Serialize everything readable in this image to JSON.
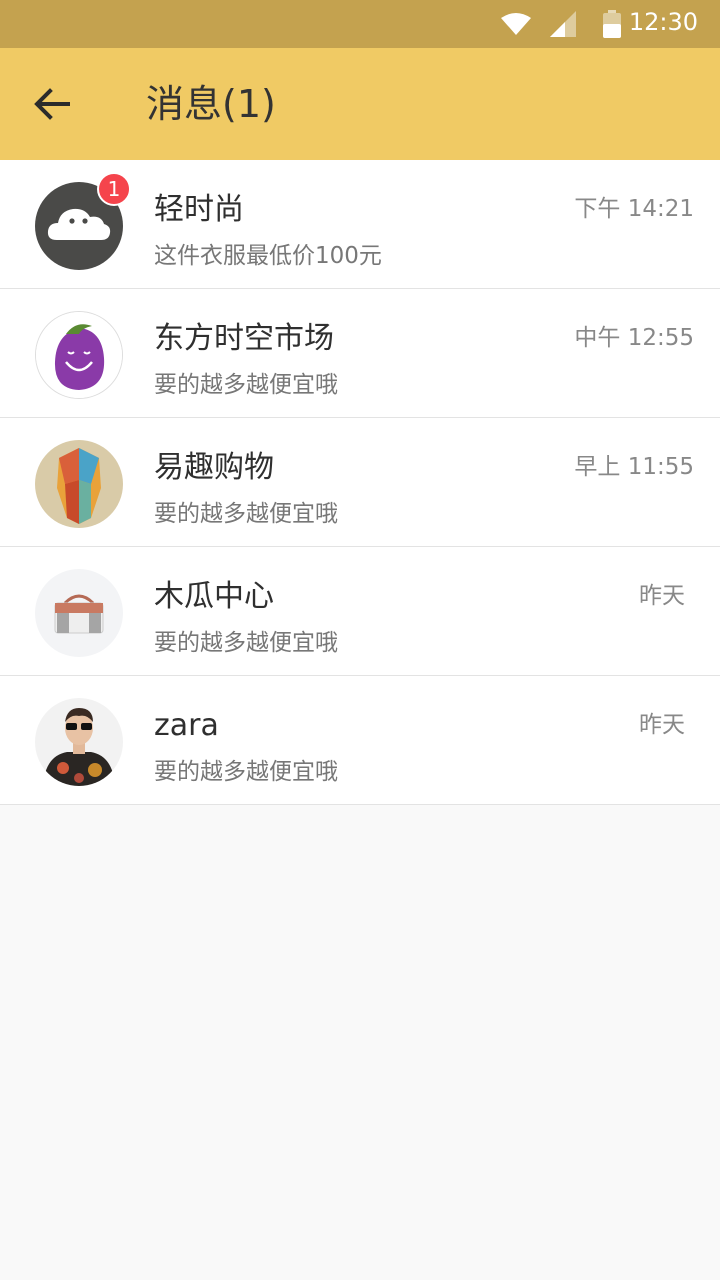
{
  "status_bar": {
    "time": "12:30",
    "icons": [
      "wifi-icon",
      "cellular-signal-icon",
      "battery-icon"
    ],
    "color": "#c4a24f"
  },
  "header": {
    "title": "消息(1)",
    "back_icon": "arrow-left-icon",
    "color": "#f0ca64"
  },
  "conversations": [
    {
      "name": "轻时尚",
      "preview": "这件衣服最低价100元",
      "time": "下午 14:21",
      "unread": "1",
      "avatar": "cloud-avatar"
    },
    {
      "name": "东方时空市场",
      "preview": "要的越多越便宜哦",
      "time": "中午 12:55",
      "avatar": "eggplant-avatar"
    },
    {
      "name": "易趣购物",
      "preview": "要的越多越便宜哦",
      "time": "早上 11:55",
      "avatar": "geometric-face-avatar"
    },
    {
      "name": "木瓜中心",
      "preview": "要的越多越便宜哦",
      "time": "昨天",
      "avatar": "handbag-avatar"
    },
    {
      "name": "zara",
      "preview": "要的越多越便宜哦",
      "time": "昨天",
      "avatar": "model-avatar"
    }
  ],
  "colors": {
    "badge": "#f5444c",
    "name_text": "#2f2f2f",
    "secondary_text": "#777777"
  }
}
